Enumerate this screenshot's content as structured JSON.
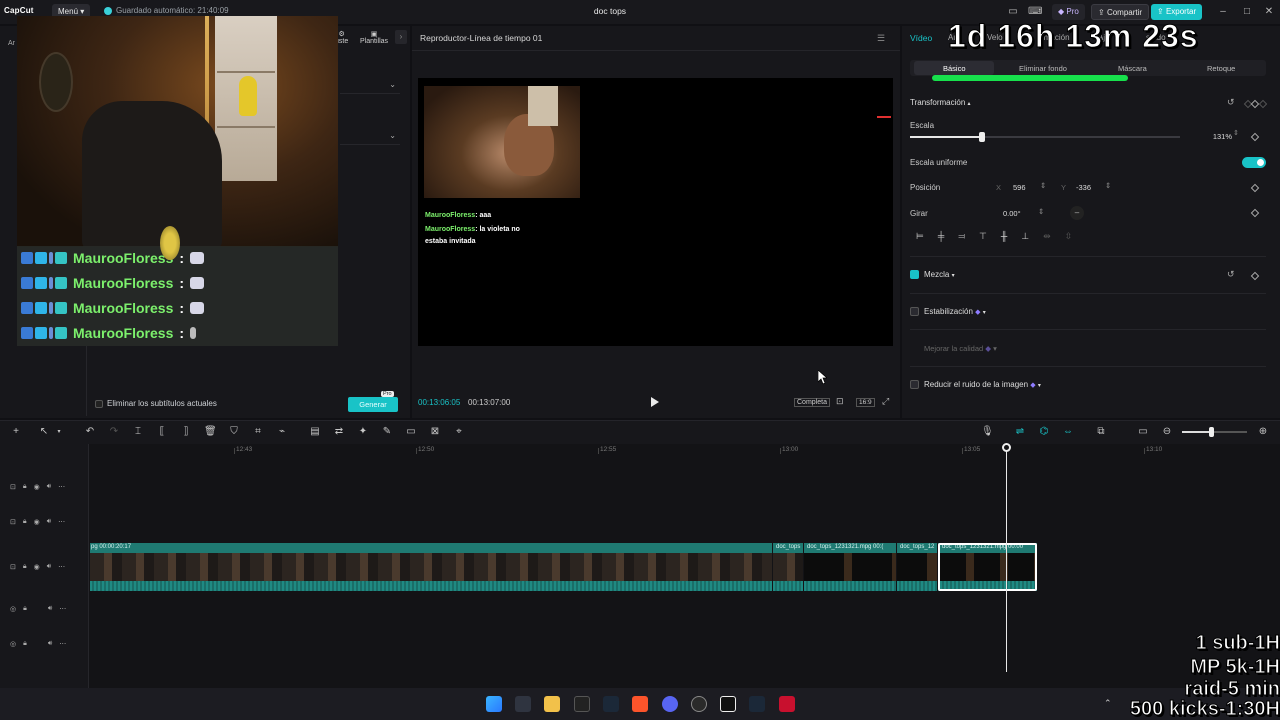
{
  "titlebar": {
    "logo": "CapCut",
    "menu_label": "Menú",
    "autosave": "Guardado automático: 21:40:09",
    "doc_title": "doc tops",
    "pro_label": "Pro",
    "share_label": "Compartir",
    "export_label": "Exportar"
  },
  "left_panel": {
    "tabs_partial": "Ar",
    "tool_adjust": "uste",
    "tool_templates": "Plantillas",
    "remove_subs_label": "Eliminar los subtítulos actuales",
    "generate_label": "Generar",
    "pro_tag": "Pro"
  },
  "chat_overlay": {
    "rows": [
      {
        "user": "MaurooFloress",
        "colon": ":"
      },
      {
        "user": "MaurooFloress",
        "colon": ":"
      },
      {
        "user": "MaurooFloress",
        "colon": ":"
      },
      {
        "user": "MaurooFloress",
        "colon": ":"
      }
    ]
  },
  "player": {
    "title": "Reproductor-Línea de tiempo 01",
    "chat": [
      {
        "user": "MaurooFloress",
        "msg": ": aaa"
      },
      {
        "user": "MaurooFloress",
        "msg": ": la violeta no"
      },
      {
        "user": "",
        "msg": "estaba invitada"
      }
    ],
    "time_current": "00:13:06:05",
    "time_total": "00:13:07:00",
    "full_label": "Completa",
    "aspect_label": "16:9"
  },
  "inspector": {
    "tab_video": "Vídeo",
    "tab_audio": "Au",
    "tab_speed": "Velo",
    "tab_anim": "imación",
    "tab_ai": "Aj",
    "tab_adjust": "stado",
    "subtabs": [
      "Básico",
      "Eliminar fondo",
      "Máscara",
      "Retoque"
    ],
    "transform_title": "Transformación",
    "scale_label": "Escala",
    "scale_value": "131%",
    "scale_fraction": 0.265,
    "uniform_scale_label": "Escala uniforme",
    "position_label": "Posición",
    "pos_x_label": "X",
    "pos_x": "596",
    "pos_y_label": "Y",
    "pos_y": "-336",
    "rotate_label": "Girar",
    "rotate_value": "0.00°",
    "blend_label": "Mezcla",
    "stabilize_label": "Estabilización",
    "quality_label": "Mejorar la calidad",
    "denoise_label": "Reducir el ruido de la imagen"
  },
  "timer_overlay": "1d 16h 13m 23s",
  "timeline": {
    "ruler": [
      "12:43",
      "12:50",
      "12:55",
      "13:00",
      "13:05",
      "13:10"
    ],
    "clips": [
      {
        "label": "pg  00:00:20:17"
      },
      {
        "label": "doc_tops"
      },
      {
        "label": "doc_tops_1231321.mpg  00:("
      },
      {
        "label": "doc_tops_12"
      },
      {
        "label": "doc_tops_1231321.mpg  00:00"
      }
    ]
  },
  "stream_info": {
    "line1": "1 sub-1H",
    "line2": "MP 5k-1H",
    "line3": "raid-5 min",
    "line4": "500 kicks-1:30H"
  },
  "colors": {
    "accent": "#19c3c7",
    "chat_user": "#7cf06c",
    "progress_green": "#17e04c",
    "clip": "#1a5e5a"
  }
}
